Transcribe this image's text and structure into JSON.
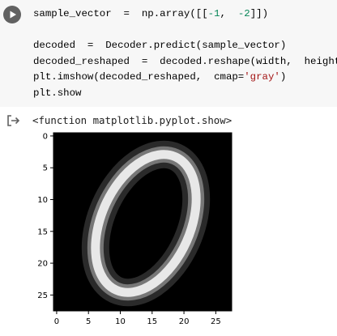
{
  "code_cell": {
    "run_button": "run",
    "lines": [
      [
        {
          "t": "sample_vector  =  np.array([["
        },
        {
          "t": "-1",
          "c": "num"
        },
        {
          "t": ",  "
        },
        {
          "t": "-2",
          "c": "num"
        },
        {
          "t": "]])"
        }
      ],
      [],
      [
        {
          "t": "decoded  =  Decoder.predict(sample_vector)"
        }
      ],
      [
        {
          "t": "decoded_reshaped  =  decoded.reshape(width,  height)"
        }
      ],
      [
        {
          "t": "plt.imshow(decoded_reshaped,  cmap="
        },
        {
          "t": "'gray'",
          "c": "str"
        },
        {
          "t": ")"
        }
      ],
      [
        {
          "t": "plt.show"
        }
      ]
    ]
  },
  "output": {
    "icon": "output-arrow-icon",
    "text": "<function matplotlib.pyplot.show>",
    "plot": {
      "colormap": "gray",
      "y_ticks": [
        "0",
        "5",
        "10",
        "15",
        "20",
        "25"
      ],
      "x_ticks": [
        "0",
        "5",
        "10",
        "15",
        "20",
        "25"
      ],
      "image_size": [
        28,
        28
      ]
    }
  }
}
